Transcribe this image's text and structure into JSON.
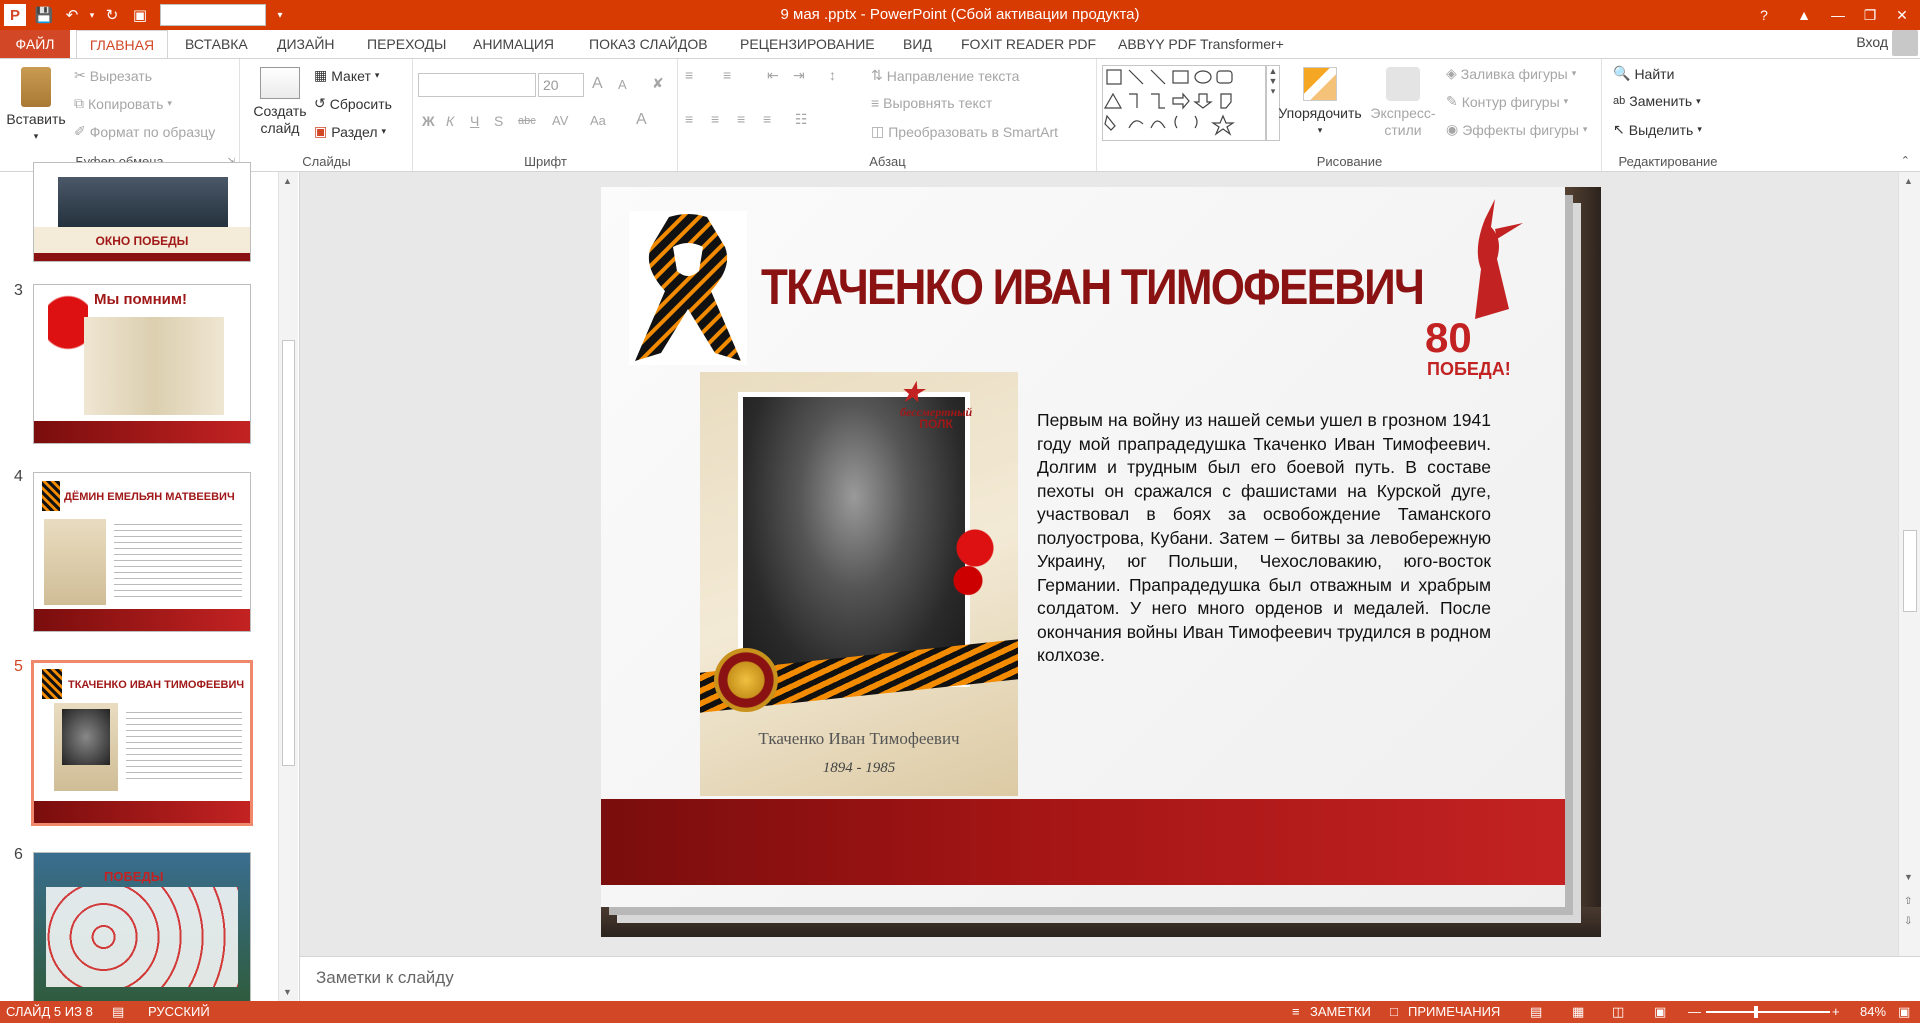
{
  "titlebar": {
    "title": "9 мая .pptx -  PowerPoint (Сбой активации продукта)",
    "help": "?"
  },
  "tabs": {
    "file": "ФАЙЛ",
    "home": "ГЛАВНАЯ",
    "insert": "ВСТАВКА",
    "design": "ДИЗАЙН",
    "transitions": "ПЕРЕХОДЫ",
    "animation": "АНИМАЦИЯ",
    "slideshow": "ПОКАЗ СЛАЙДОВ",
    "review": "РЕЦЕНЗИРОВАНИЕ",
    "view": "ВИД",
    "foxit": "FOXIT READER PDF",
    "abbyy": "ABBYY PDF Transformer+",
    "signin": "Вход"
  },
  "ribbon": {
    "clipboard": {
      "paste": "Вставить",
      "cut": "Вырезать",
      "copy": "Копировать",
      "format_painter": "Формат по образцу",
      "label": "Буфер обмена"
    },
    "slides": {
      "new_slide": "Создать",
      "new_slide2": "слайд",
      "layout": "Макет",
      "reset": "Сбросить",
      "section": "Раздел",
      "label": "Слайды"
    },
    "font": {
      "size": "20",
      "bold": "Ж",
      "italic": "К",
      "underline": "Ч",
      "shadow": "S",
      "strike": "abc",
      "spacing": "AV",
      "case": "Aa",
      "color": "A",
      "grow": "A",
      "shrink": "A",
      "label": "Шрифт"
    },
    "paragraph": {
      "text_direction": "Направление текста",
      "align_text": "Выровнять текст",
      "smartart": "Преобразовать в SmartArt",
      "label": "Абзац"
    },
    "drawing": {
      "arrange": "Упорядочить",
      "quick_styles": "Экспресс-",
      "quick_styles2": "стили",
      "fill": "Заливка фигуры",
      "outline": "Контур фигуры",
      "effects": "Эффекты фигуры",
      "label": "Рисование"
    },
    "editing": {
      "find": "Найти",
      "replace": "Заменить",
      "select": "Выделить",
      "label": "Редактирование"
    }
  },
  "thumbnails": [
    {
      "num": "",
      "caption": "ОКНО ПОБЕДЫ"
    },
    {
      "num": "3",
      "caption": "Мы помним!"
    },
    {
      "num": "4",
      "caption": "ДЁМИН ЕМЕЛЬЯН МАТВЕЕВИЧ"
    },
    {
      "num": "5",
      "caption": "ТКАЧЕНКО ИВАН ТИМОФЕЕВИЧ"
    },
    {
      "num": "6",
      "caption": "ПОБЕДЫ"
    }
  ],
  "slide": {
    "title": "ТКАЧЕНКО ИВАН ТИМОФЕЕВИЧ",
    "badge_80": "80",
    "badge_victory": "ПОБЕДА!",
    "regiment_1": "бессмертный",
    "regiment_2": "ПОЛК",
    "photo_name": "Ткаченко Иван Тимофеевич",
    "photo_years": "1894 - 1985",
    "body": "Первым на войну из нашей семьи ушел в грозном 1941 году мой прапрадедушка Ткаченко Иван Тимофеевич. Долгим и трудным был его боевой путь. В составе пехоты он сражался с фашистами на Курской дуге, участвовал в боях за освобождение Таманского полуострова, Кубани. Затем – битвы за левобережную Украину, юг Польши, Чехословакию, юго-восток Германии. Прапрадедушка был отважным и храбрым солдатом. У него много орденов и медалей. После окончания войны Иван Тимофеевич трудился в родном колхозе."
  },
  "notes_placeholder": "Заметки к слайду",
  "status": {
    "slide_of": "СЛАЙД 5 ИЗ 8",
    "language": "РУССКИЙ",
    "notes": "ЗАМЕТКИ",
    "comments": "ПРИМЕЧАНИЯ",
    "zoom": "84%"
  },
  "colors": {
    "accent": "#d24726",
    "titlebar": "#d83b01",
    "slide_title": "#8b1212"
  }
}
